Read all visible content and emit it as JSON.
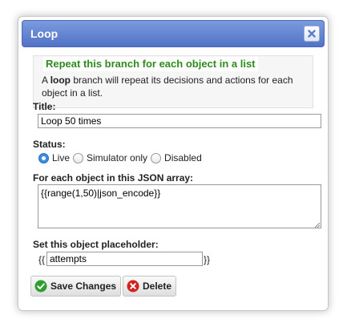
{
  "dialog": {
    "title": "Loop",
    "close_icon": "close-x-icon"
  },
  "info": {
    "heading": "Repeat this branch for each object in a list",
    "text_prefix": "A ",
    "text_bold": "loop",
    "text_suffix": " branch will repeat its decisions and actions for each object in a list."
  },
  "form": {
    "title_label": "Title:",
    "title_value": "Loop 50 times",
    "status_label": "Status:",
    "status_options": [
      {
        "label": "Live",
        "checked": true
      },
      {
        "label": "Simulator only",
        "checked": false
      },
      {
        "label": "Disabled",
        "checked": false
      }
    ],
    "array_label": "For each object in this JSON array:",
    "array_value": "{{range(1,50)|json_encode}}",
    "placeholder_label": "Set this object placeholder:",
    "placeholder_open": "{{",
    "placeholder_value": "attempts",
    "placeholder_close": "}}"
  },
  "buttons": {
    "save_label": "Save Changes",
    "delete_label": "Delete"
  },
  "colors": {
    "titlebar": "#5b7bd0",
    "heading_green": "#2f8a1f",
    "radio_checked": "#3b8de0",
    "save_icon": "#2e9e2e",
    "delete_icon": "#d32222"
  }
}
